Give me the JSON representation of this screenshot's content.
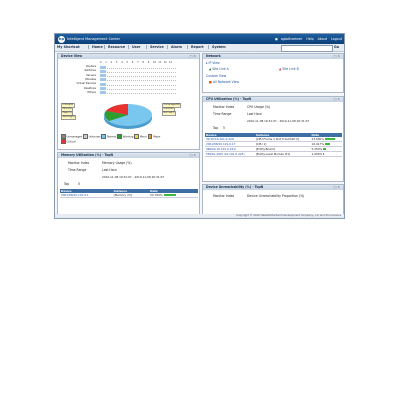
{
  "app": {
    "title": "Intelligent Management Center",
    "user": "sgboltramner",
    "user_links": [
      "Help",
      "About",
      "Logout"
    ]
  },
  "menu": {
    "shortcut": "My Shortcut",
    "items": [
      "Home",
      "Resource",
      "User",
      "Service",
      "Alarm",
      "Report",
      "System"
    ],
    "go": "Go"
  },
  "device_view": {
    "title": "Device View",
    "ticks": [
      "0",
      "1",
      "2",
      "3",
      "4",
      "5",
      "6",
      "7",
      "8",
      "9",
      "10",
      "11",
      "12",
      "13"
    ],
    "categories": [
      "Routers",
      "Switches",
      "Servers",
      "Wireless",
      "Virtual Devices",
      "Desktops",
      "Others"
    ],
    "legend": [
      "Unmanaged",
      "Unknown",
      "Normal",
      "Warning",
      "Minor",
      "Major",
      "Critical"
    ],
    "callouts_left": [
      "Critical(0)",
      "Minor(0)",
      "Major(1)",
      "Warning(0)"
    ],
    "callouts_right": [
      "Unmanaged(0)",
      "Unknown",
      "Normal(3)"
    ]
  },
  "network": {
    "title": "Network",
    "ip_view": "IP View",
    "link_a": "Site Link A",
    "link_b": "Site Link B",
    "custom_view": "Custom View",
    "all_network": "All Network View"
  },
  "cpu": {
    "title": "CPU Utilization (%) - TopN",
    "monitor_index_label": "Monitor Index",
    "monitor_index": "CPU Usage (%)",
    "time_range_label": "Time Range",
    "time_range": "Last Hour",
    "time_span": "2010-11-08 19:31:07 - 2010-11-08 20:31:07",
    "top_label": "Top",
    "top": "5",
    "columns": [
      "Device",
      "Instance",
      "Data"
    ],
    "rows": [
      {
        "device": "42/10/16.101.0.220",
        "instance": "[CPU.Frame 1 Slot 0 SubSlot 0]",
        "data": "23.000%"
      },
      {
        "device": "2001/88/10.101.0.17",
        "instance": "[CPU 1]",
        "data": "10.417%"
      },
      {
        "device": "4600G(10.101.0.221)",
        "instance": "[Entity.Board]",
        "data": "5.250%"
      },
      {
        "device": "5500G-4GPI (10.101.0.225)",
        "instance": "[Entity.Level.Module #1]",
        "data": "1.000%"
      }
    ],
    "bars": [
      0.46,
      0.21,
      0.11,
      0.02
    ]
  },
  "memory": {
    "title": "Memory Utilization (%) - TopN",
    "monitor_index_label": "Monitor Index",
    "monitor_index": "Memory Usage (%)",
    "time_range_label": "Time Range",
    "time_range": "Last Hour",
    "time_span": "2010-11-08 19:31:07 - 2010-11-08 20:31:07",
    "top_label": "Top",
    "top": "5",
    "columns": [
      "Device",
      "Instance",
      "Data"
    ],
    "rows": [
      {
        "device": "2001/88/10.101.0.1",
        "instance": "[Memory (C)]",
        "data": "54.764%"
      }
    ],
    "bars": [
      0.55
    ]
  },
  "unreach": {
    "title": "Device Unreachability (%) - TopN",
    "monitor_index_label": "Monitor Index",
    "monitor_index": "Device Unreachability Proportion (%)"
  },
  "footer": "Copyright © 2010 Hewlett-Packard Development Company, L.P. and its licensors",
  "colors": {
    "titlebar": "#0c3f78",
    "table_header": "#3d6fa5",
    "bar_fill": "#6ea4dc",
    "status_bar": "#3cba3c",
    "pie_normal": "#79c6ef",
    "pie_critical": "#e8322d",
    "pie_warning": "#2e9e2e"
  }
}
